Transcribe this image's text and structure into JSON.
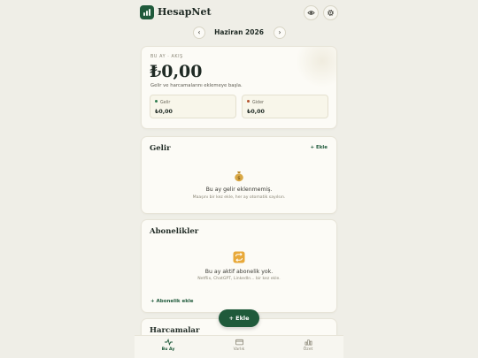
{
  "app": {
    "name": "HesapNet"
  },
  "month_nav": {
    "label": "Haziran 2026",
    "prev": "‹",
    "next": "›"
  },
  "summary": {
    "kicker": "BU AY · AKIŞ",
    "balance": "₺0,00",
    "hint": "Gelir ve harcamalarını eklemeye başla.",
    "income": {
      "label": "Gelir",
      "value": "₺0,00",
      "color": "#2f7d4f"
    },
    "expense": {
      "label": "Gider",
      "value": "₺0,00",
      "color": "#b5542f"
    }
  },
  "income_section": {
    "title": "Gelir",
    "add": "+ Ekle",
    "empty_icon": "money-bag-icon",
    "empty_title": "Bu ay gelir eklenmemiş.",
    "empty_sub": "Maaşını bir kez ekle, her ay otomatik sayılsın."
  },
  "subscriptions_section": {
    "title": "Abonelikler",
    "empty_icon": "repeat-icon",
    "empty_title": "Bu ay aktif abonelik yok.",
    "empty_sub": "Netflix, ChatGPT, LinkedIn... bir kez ekle.",
    "add": "+ Abonelik ekle"
  },
  "expenses_section": {
    "title": "Harcamalar"
  },
  "fab": {
    "label": "+ Ekle"
  },
  "bottom_nav": [
    {
      "label": "Bu Ay",
      "icon": "pulse-icon",
      "active": true
    },
    {
      "label": "Varlık",
      "icon": "wallet-icon",
      "active": false
    },
    {
      "label": "Özet",
      "icon": "bar-chart-icon",
      "active": false
    }
  ],
  "colors": {
    "accent": "#1f5a3b",
    "background": "#efeee7",
    "card": "#fcfbf6"
  }
}
